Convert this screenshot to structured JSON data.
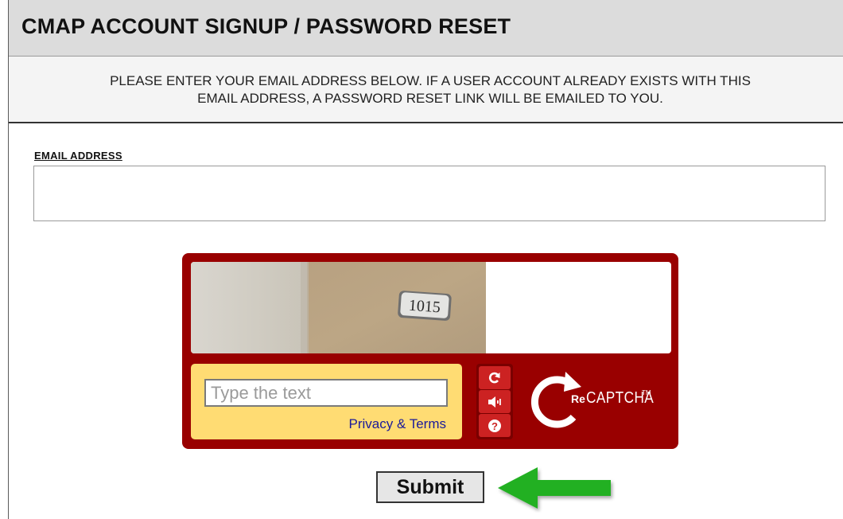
{
  "header": {
    "title": "CMAP ACCOUNT SIGNUP / PASSWORD RESET"
  },
  "instructions": {
    "text": "PLEASE ENTER YOUR EMAIL ADDRESS BELOW. IF A USER ACCOUNT ALREADY EXISTS WITH THIS\nEMAIL ADDRESS, A PASSWORD RESET LINK WILL BE EMAILED TO YOU."
  },
  "form": {
    "email_label": "EMAIL ADDRESS",
    "email_value": "",
    "submit_label": "Submit"
  },
  "captcha": {
    "image_text": "1015",
    "input_placeholder": "Type the text",
    "privacy_link": "Privacy & Terms",
    "buttons": [
      "refresh-icon",
      "audio-icon",
      "help-icon"
    ],
    "logo_re": "Re",
    "logo_word": "CAPTCHA",
    "logo_tm": "TM"
  },
  "colors": {
    "header_bg": "#dcdcdc",
    "captcha_frame": "#990000",
    "captcha_input_box": "#ffdc73",
    "link": "#1a1a9a",
    "arrow": "#22b022"
  }
}
